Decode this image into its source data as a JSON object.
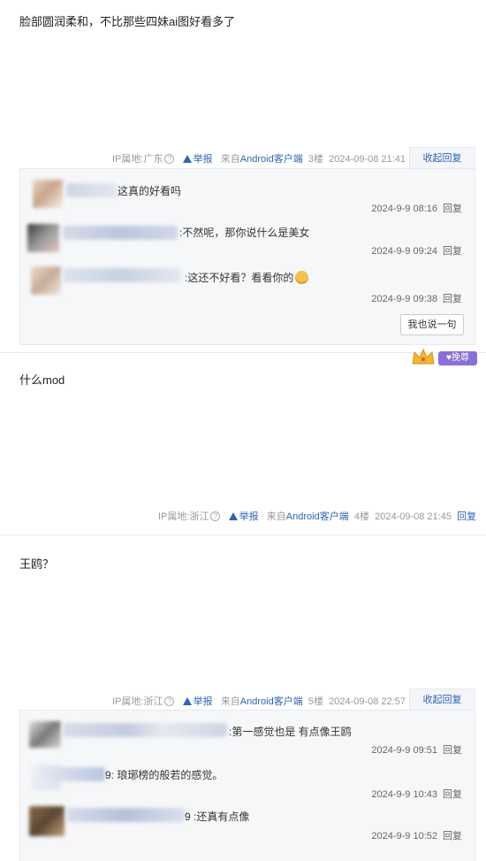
{
  "floor3": {
    "content": "脸部圆润柔和，不比那些四妹ai图好看多了",
    "ip": "IP属地:广东",
    "report": "举报",
    "source": "来自Android客户端",
    "floor": "3楼",
    "time": "2024-09-08 21:41",
    "collapse": "收起回复",
    "comments": [
      {
        "text": "这真的好看吗",
        "time": "2024-9-9 08:16",
        "reply": "回复"
      },
      {
        "text": ":不然呢，那你说什么是美女",
        "time": "2024-9-9 09:24",
        "reply": "回复"
      },
      {
        "text": ":这还不好看？看看你的",
        "time": "2024-9-9 09:38",
        "reply": "回复"
      }
    ],
    "say_button": "我也说一句"
  },
  "badge": {
    "label": "挽尊"
  },
  "floor4": {
    "content": "什么mod",
    "ip": "IP属地:浙江",
    "report": "举报",
    "source": "来自Android客户端",
    "floor": "4楼",
    "time": "2024-09-08 21:45",
    "reply": "回复"
  },
  "floor5": {
    "content": "王鸥？",
    "ip": "IP属地:浙江",
    "report": "举报",
    "source": "来自Android客户端",
    "floor": "5楼",
    "time": "2024-09-08 22:57",
    "collapse": "收起回复",
    "comments": [
      {
        "text": ":第一感觉也是 有点像王鸥",
        "time": "2024-9-9 09:51",
        "reply": "回复"
      },
      {
        "text": "9: 琅琊榜的般若的感觉。",
        "time": "2024-9-9 10:43",
        "reply": "回复"
      },
      {
        "text": "9 :还真有点像",
        "time": "2024-9-9 10:52",
        "reply": "回复"
      }
    ]
  },
  "colors": {
    "link": "#2d64b3",
    "meta": "#999999",
    "lzl_bg": "#f6f7f9"
  }
}
